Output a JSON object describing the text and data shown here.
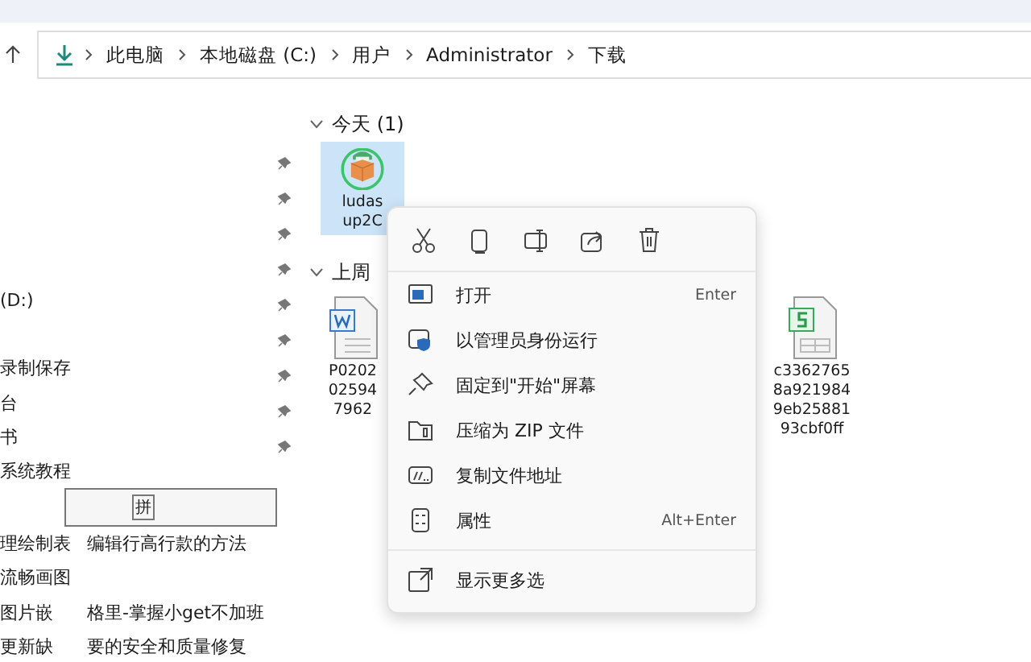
{
  "address_bar": {
    "crumbs": [
      "此电脑",
      "本地磁盘 (C:)",
      "用户",
      "Administrator",
      "下载"
    ]
  },
  "nav_pane": {
    "rows": [
      {
        "kind": "item",
        "texts": [
          "(D:)"
        ]
      },
      {
        "kind": "gap",
        "texts": []
      },
      {
        "kind": "item",
        "texts": [
          "录制保存"
        ]
      },
      {
        "kind": "item",
        "texts": [
          "台"
        ]
      },
      {
        "kind": "item",
        "texts": [
          "书"
        ]
      },
      {
        "kind": "item",
        "texts": [
          "系统教程"
        ]
      },
      {
        "kind": "ime",
        "texts": [
          "拼"
        ]
      },
      {
        "kind": "item",
        "texts": [
          "理绘制表",
          "编辑行高行款的方法"
        ]
      },
      {
        "kind": "item",
        "texts": [
          "流畅画图"
        ]
      },
      {
        "kind": "item",
        "texts": [
          "图片嵌",
          "格里-掌握小get不加班"
        ]
      },
      {
        "kind": "item",
        "texts": [
          "更新缺",
          "要的安全和质量修复"
        ]
      }
    ]
  },
  "groups": [
    {
      "title": "今天 (1)",
      "expanded": true,
      "files": [
        {
          "kind": "package",
          "selected": true,
          "name_lines": [
            "ludas",
            "up2C"
          ]
        }
      ]
    },
    {
      "title": "上周",
      "expanded": true,
      "files": [
        {
          "kind": "word",
          "selected": false,
          "name_lines": [
            "P0202",
            "02594",
            "7962"
          ]
        },
        {
          "kind": "sheet",
          "selected": false,
          "name_lines": [
            "c3362765",
            "8a921984",
            "9eb25881",
            "93cbf0ff"
          ]
        }
      ]
    }
  ],
  "context_menu": {
    "items": [
      {
        "label": "打开",
        "shortcut": "Enter",
        "separated": false
      },
      {
        "label": "以管理员身份运行",
        "separated": false
      },
      {
        "label": "固定到\"开始\"屏幕",
        "separated": false
      },
      {
        "label": "压缩为 ZIP 文件",
        "separated": false
      },
      {
        "label": "复制文件地址",
        "separated": false
      },
      {
        "label": "属性",
        "shortcut": "Alt+Enter",
        "separated": false
      },
      {
        "label": "显示更多选",
        "separated": true
      }
    ]
  }
}
